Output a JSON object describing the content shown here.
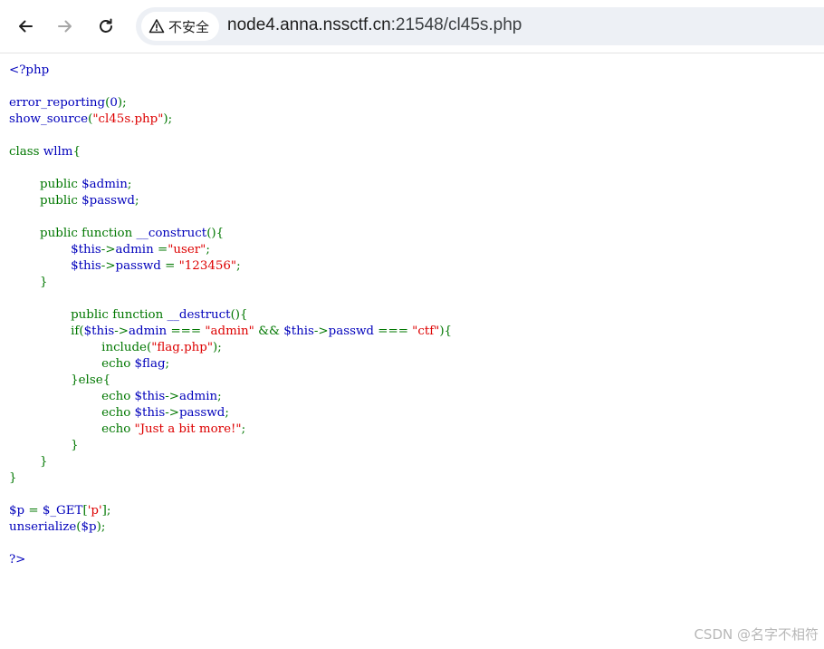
{
  "browser": {
    "security_label": "不安全",
    "url_host": "node4.anna.nssctf.cn",
    "url_path": ":21548/cl45s.php"
  },
  "colors": {
    "default": "#0000BB",
    "keyword": "#007700",
    "string": "#DD0000"
  },
  "source_lines": [
    [
      {
        "t": "<?php",
        "c": "default"
      }
    ],
    [],
    [
      {
        "t": "error_reporting",
        "c": "default"
      },
      {
        "t": "(",
        "c": "keyword"
      },
      {
        "t": "0",
        "c": "default"
      },
      {
        "t": ");",
        "c": "keyword"
      }
    ],
    [
      {
        "t": "show_source",
        "c": "default"
      },
      {
        "t": "(",
        "c": "keyword"
      },
      {
        "t": "\"cl45s.php\"",
        "c": "string"
      },
      {
        "t": ");",
        "c": "keyword"
      }
    ],
    [],
    [
      {
        "t": "class ",
        "c": "keyword"
      },
      {
        "t": "wllm",
        "c": "default"
      },
      {
        "t": "{",
        "c": "keyword"
      }
    ],
    [],
    [
      {
        "t": "        public ",
        "c": "keyword"
      },
      {
        "t": "$admin",
        "c": "default"
      },
      {
        "t": ";",
        "c": "keyword"
      }
    ],
    [
      {
        "t": "        public ",
        "c": "keyword"
      },
      {
        "t": "$passwd",
        "c": "default"
      },
      {
        "t": ";",
        "c": "keyword"
      }
    ],
    [],
    [
      {
        "t": "        public function ",
        "c": "keyword"
      },
      {
        "t": "__construct",
        "c": "default"
      },
      {
        "t": "(){",
        "c": "keyword"
      }
    ],
    [
      {
        "t": "                ",
        "c": "keyword"
      },
      {
        "t": "$this",
        "c": "default"
      },
      {
        "t": "->",
        "c": "keyword"
      },
      {
        "t": "admin ",
        "c": "default"
      },
      {
        "t": "=",
        "c": "keyword"
      },
      {
        "t": "\"user\"",
        "c": "string"
      },
      {
        "t": ";",
        "c": "keyword"
      }
    ],
    [
      {
        "t": "                ",
        "c": "keyword"
      },
      {
        "t": "$this",
        "c": "default"
      },
      {
        "t": "->",
        "c": "keyword"
      },
      {
        "t": "passwd ",
        "c": "default"
      },
      {
        "t": "= ",
        "c": "keyword"
      },
      {
        "t": "\"123456\"",
        "c": "string"
      },
      {
        "t": ";",
        "c": "keyword"
      }
    ],
    [
      {
        "t": "        }",
        "c": "keyword"
      }
    ],
    [],
    [
      {
        "t": "                public function ",
        "c": "keyword"
      },
      {
        "t": "__destruct",
        "c": "default"
      },
      {
        "t": "(){",
        "c": "keyword"
      }
    ],
    [
      {
        "t": "                if(",
        "c": "keyword"
      },
      {
        "t": "$this",
        "c": "default"
      },
      {
        "t": "->",
        "c": "keyword"
      },
      {
        "t": "admin ",
        "c": "default"
      },
      {
        "t": "=== ",
        "c": "keyword"
      },
      {
        "t": "\"admin\" ",
        "c": "string"
      },
      {
        "t": "&& ",
        "c": "keyword"
      },
      {
        "t": "$this",
        "c": "default"
      },
      {
        "t": "->",
        "c": "keyword"
      },
      {
        "t": "passwd ",
        "c": "default"
      },
      {
        "t": "=== ",
        "c": "keyword"
      },
      {
        "t": "\"ctf\"",
        "c": "string"
      },
      {
        "t": "){",
        "c": "keyword"
      }
    ],
    [
      {
        "t": "                        include(",
        "c": "keyword"
      },
      {
        "t": "\"flag.php\"",
        "c": "string"
      },
      {
        "t": ");",
        "c": "keyword"
      }
    ],
    [
      {
        "t": "                        echo ",
        "c": "keyword"
      },
      {
        "t": "$flag",
        "c": "default"
      },
      {
        "t": ";",
        "c": "keyword"
      }
    ],
    [
      {
        "t": "                }else{",
        "c": "keyword"
      }
    ],
    [
      {
        "t": "                        echo ",
        "c": "keyword"
      },
      {
        "t": "$this",
        "c": "default"
      },
      {
        "t": "->",
        "c": "keyword"
      },
      {
        "t": "admin",
        "c": "default"
      },
      {
        "t": ";",
        "c": "keyword"
      }
    ],
    [
      {
        "t": "                        echo ",
        "c": "keyword"
      },
      {
        "t": "$this",
        "c": "default"
      },
      {
        "t": "->",
        "c": "keyword"
      },
      {
        "t": "passwd",
        "c": "default"
      },
      {
        "t": ";",
        "c": "keyword"
      }
    ],
    [
      {
        "t": "                        echo ",
        "c": "keyword"
      },
      {
        "t": "\"Just a bit more!\"",
        "c": "string"
      },
      {
        "t": ";",
        "c": "keyword"
      }
    ],
    [
      {
        "t": "                }",
        "c": "keyword"
      }
    ],
    [
      {
        "t": "        }",
        "c": "keyword"
      }
    ],
    [
      {
        "t": "}",
        "c": "keyword"
      }
    ],
    [],
    [
      {
        "t": "$p ",
        "c": "default"
      },
      {
        "t": "= ",
        "c": "keyword"
      },
      {
        "t": "$_GET",
        "c": "default"
      },
      {
        "t": "[",
        "c": "keyword"
      },
      {
        "t": "'p'",
        "c": "string"
      },
      {
        "t": "];",
        "c": "keyword"
      }
    ],
    [
      {
        "t": "unserialize",
        "c": "default"
      },
      {
        "t": "(",
        "c": "keyword"
      },
      {
        "t": "$p",
        "c": "default"
      },
      {
        "t": ");",
        "c": "keyword"
      }
    ],
    [],
    [
      {
        "t": "?>",
        "c": "default"
      }
    ]
  ],
  "watermark": "CSDN @名字不相符"
}
